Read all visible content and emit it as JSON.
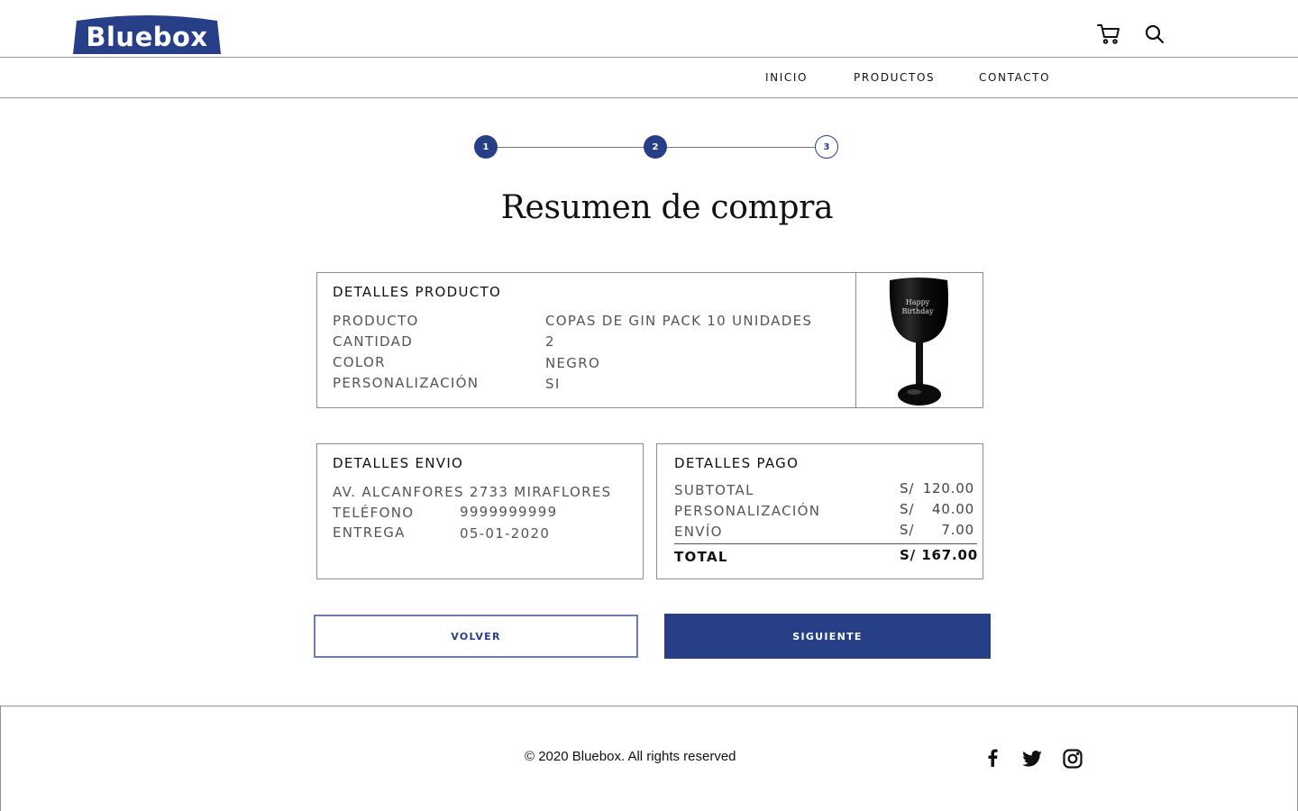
{
  "brand": {
    "name": "Bluebox",
    "color": "#263f86"
  },
  "header": {
    "nav": [
      {
        "label": "INICIO"
      },
      {
        "label": "PRODUCTOS"
      },
      {
        "label": "CONTACTO"
      }
    ],
    "icons": [
      "cart-icon",
      "search-icon"
    ]
  },
  "stepper": {
    "steps": [
      "1",
      "2",
      "3"
    ],
    "current": 2
  },
  "page_title": "Resumen de compra",
  "product": {
    "title": "DETALLES PRODUCTO",
    "rows": [
      {
        "label": "PRODUCTO",
        "value": "COPAS DE GIN PACK 10 UNIDADES"
      },
      {
        "label": "CANTIDAD",
        "value": "2"
      },
      {
        "label": "COLOR",
        "value": "NEGRO"
      },
      {
        "label": "PERSONALIZACIÓN",
        "value": "SI"
      }
    ],
    "image_text": [
      "Happy",
      "Birthday"
    ]
  },
  "shipping": {
    "title": "DETALLES ENVIO",
    "address": "AV. ALCANFORES 2733 MIRAFLORES",
    "rows": [
      {
        "label": "TELÉFONO",
        "value": "9999999999"
      },
      {
        "label": "ENTREGA",
        "value": "05-01-2020"
      }
    ]
  },
  "payment": {
    "title": "DETALLES PAGO",
    "currency": "S/",
    "rows": [
      {
        "label": "SUBTOTAL",
        "amount": "120.00"
      },
      {
        "label": "PERSONALIZACIÓN",
        "amount": "40.00"
      },
      {
        "label": "ENVÍO",
        "amount": "7.00"
      }
    ],
    "total": {
      "label": "TOTAL",
      "amount": "167.00"
    }
  },
  "buttons": {
    "back": "VOLVER",
    "next": "SIGUIENTE"
  },
  "footer": {
    "copyright": "© 2020 Bluebox. All rights reserved",
    "social": [
      "facebook-icon",
      "twitter-icon",
      "instagram-icon"
    ]
  }
}
